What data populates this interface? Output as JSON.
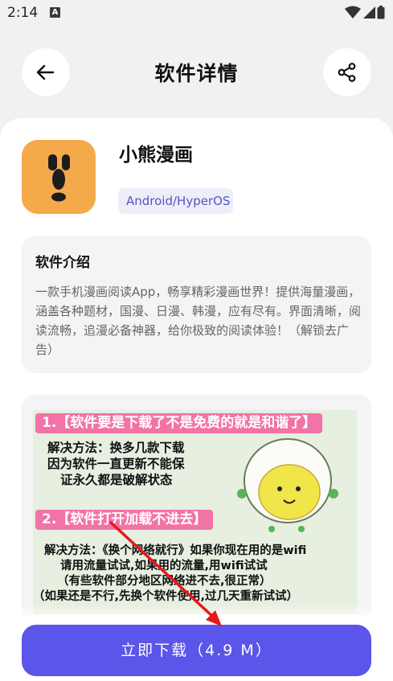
{
  "status_bar": {
    "time": "2:14",
    "notification_letter": "A"
  },
  "header": {
    "title": "软件详情"
  },
  "app": {
    "name": "小熊漫画",
    "platform": "Android/HyperOS"
  },
  "intro": {
    "title": "软件介绍",
    "text": "一款手机漫画阅读App，畅享精彩漫画世界！提供海量漫画，涵盖各种题材，国漫、日漫、韩漫，应有尽有。界面清晰，阅读流畅，追漫必备神器，给你极致的阅读体验！（解锁去广告）"
  },
  "screenshot": {
    "banner1": "1.【软件要是下载了不是免费的就是和谐了】",
    "solution1_lines": [
      "解决方法：换多几款下载",
      "因为软件一直更新不能保",
      "证永久都是破解状态"
    ],
    "banner2": "2.【软件打开加载不进去】",
    "solution2_lines": [
      "解决方法：《换个网络就行》如果你现在用的是wifi",
      "请用流量试试,如果用的流量,用wifi试试",
      "（有些软件部分地区网络进不去,很正常）",
      "（如果还是不行,先换个软件使用,过几天重新试试）"
    ]
  },
  "download": {
    "label": "立即下载（4.9 M）"
  },
  "colors": {
    "accent": "#5b55ea",
    "app_icon_bg": "#f4a94a",
    "arrow": "#e81818",
    "banner": "#f273a6"
  }
}
